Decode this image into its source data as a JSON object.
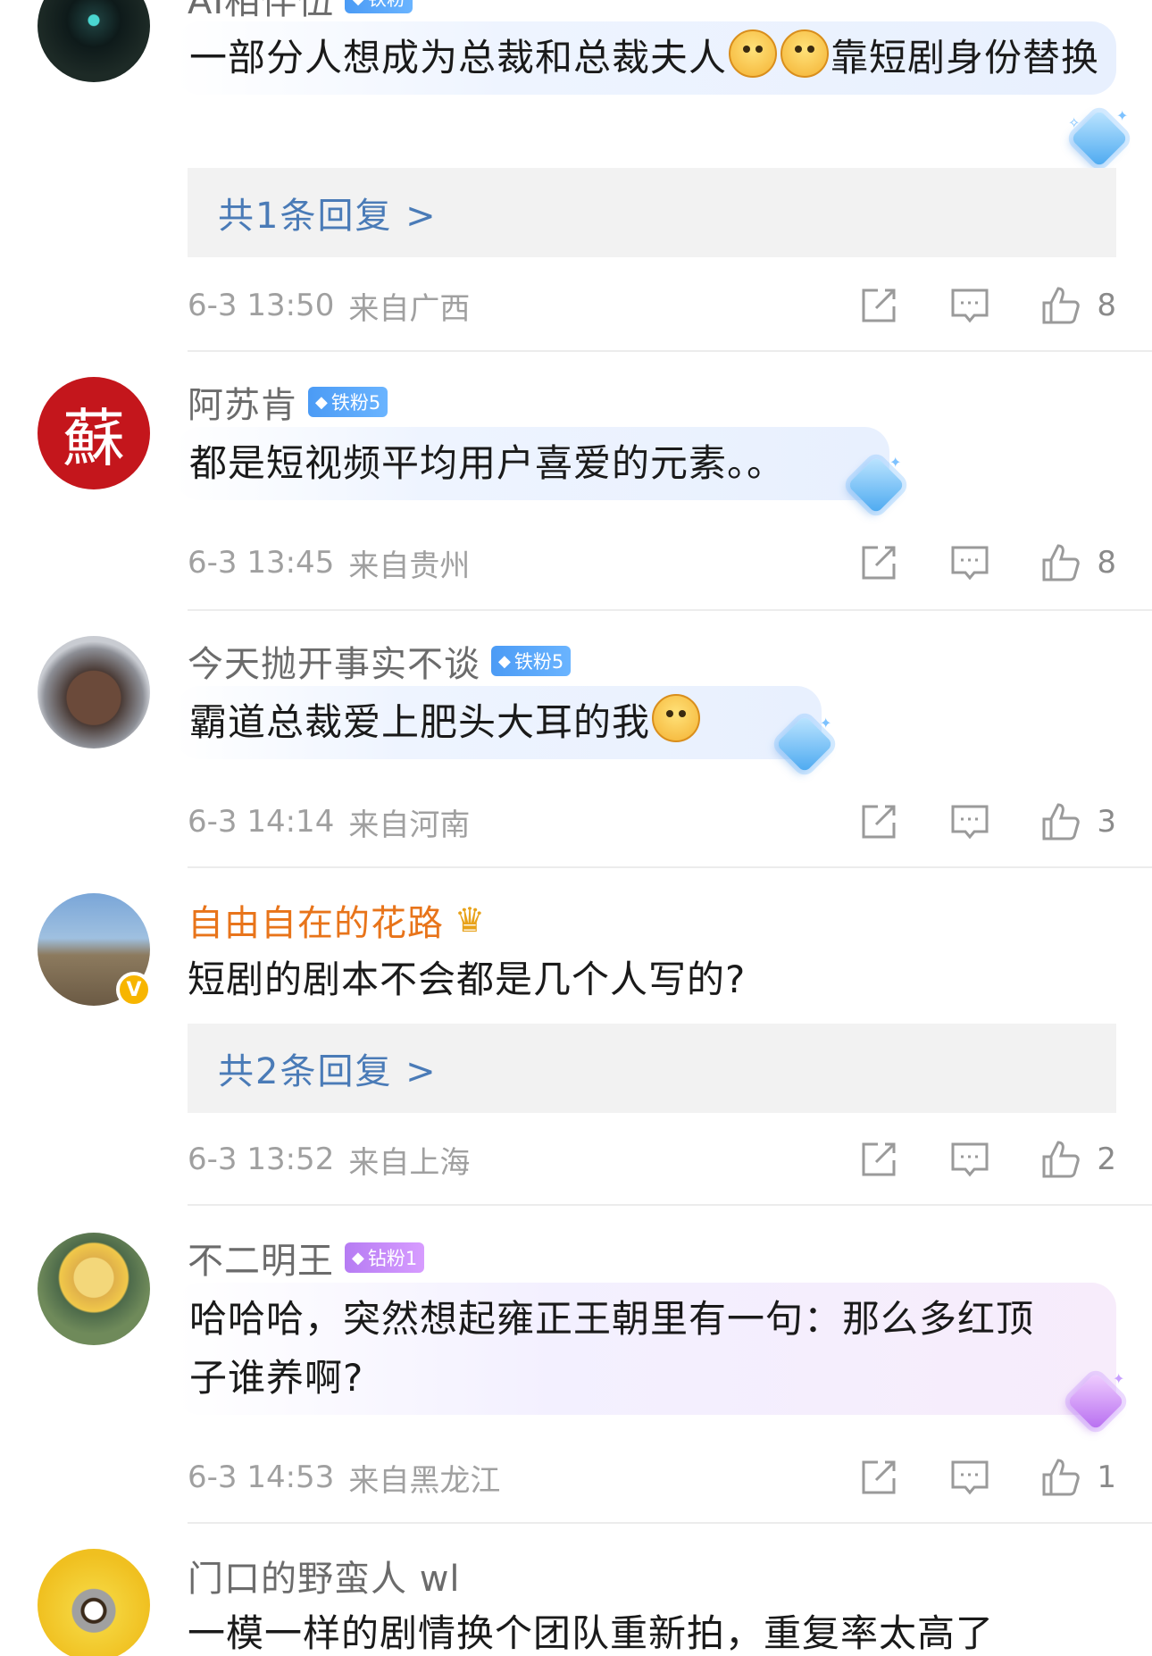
{
  "comments": [
    {
      "username": "AI相伴伍",
      "badge": "铁粉",
      "text_before": "一部分人想成为总裁和总裁夫人",
      "text_after": "靠短剧身份替换",
      "reply_link": "共1条回复 >",
      "time": "6-3 13:50",
      "location": "来自广西",
      "likes": "8"
    },
    {
      "username": "阿苏肯",
      "badge": "铁粉5",
      "text": "都是短视频平均用户喜爱的元素。。",
      "time": "6-3 13:45",
      "location": "来自贵州",
      "likes": "8"
    },
    {
      "username": "今天抛开事实不谈",
      "badge": "铁粉5",
      "text": "霸道总裁爱上肥头大耳的我",
      "time": "6-3 14:14",
      "location": "来自河南",
      "likes": "3"
    },
    {
      "username": "自由自在的花路",
      "text": "短剧的剧本不会都是几个人写的?",
      "reply_link": "共2条回复 >",
      "time": "6-3 13:52",
      "location": "来自上海",
      "likes": "2"
    },
    {
      "username": "不二明王",
      "badge": "钻粉1",
      "text_line1": "哈哈哈，突然想起雍正王朝里有一句：那么多红顶",
      "text_line2": "子谁养啊?",
      "time": "6-3 14:53",
      "location": "来自黑龙江",
      "likes": "1"
    },
    {
      "username": "门口的野蛮人 wl",
      "text": "一模一样的剧情换个团队重新拍，重复率太高了"
    }
  ],
  "icons": {
    "repost": "repost-icon",
    "comment": "comment-icon",
    "like": "thumbs-up-icon"
  },
  "colors": {
    "link": "#4a7bb7",
    "meta": "#a0a0a0",
    "gold_name": "#e8741a",
    "badge_blue": "#4b9bf5",
    "badge_purple": "#b67cf3"
  }
}
